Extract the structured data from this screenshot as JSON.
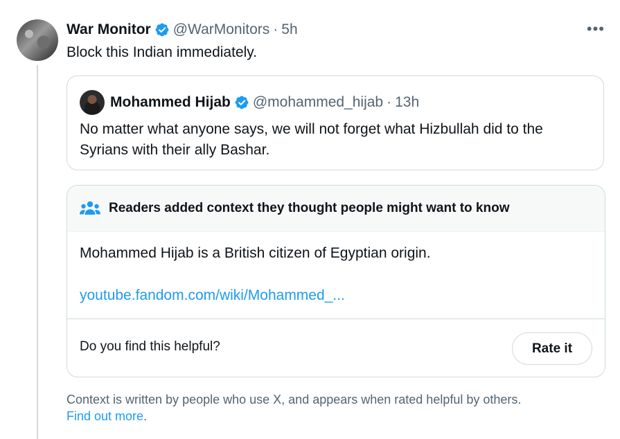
{
  "tweet": {
    "author_name": "War Monitor",
    "handle": "@WarMonitors",
    "separator": "·",
    "time": "5h",
    "text": "Block this Indian immediately.",
    "more_icon": "more-horizontal-icon"
  },
  "quoted": {
    "author_name": "Mohammed Hijab",
    "handle": "@mohammed_hijab",
    "separator": "·",
    "time": "13h",
    "text": "No matter what anyone says, we will not forget what Hizbullah did to the Syrians with their ally Bashar."
  },
  "community_note": {
    "title": "Readers added context they thought people might want to know",
    "body": "Mohammed Hijab is a British citizen of Egyptian origin.",
    "link": "youtube.fandom.com/wiki/Mohammed_...",
    "helpful_prompt": "Do you find this helpful?",
    "rate_label": "Rate it"
  },
  "footer": {
    "text": "Context is written by people who use X, and appears when rated helpful by others.",
    "link": "Find out more",
    "period": "."
  },
  "colors": {
    "verified": "#1d9bf0",
    "link": "#1d9bf0",
    "muted": "#536471",
    "border": "#cfd9de"
  }
}
